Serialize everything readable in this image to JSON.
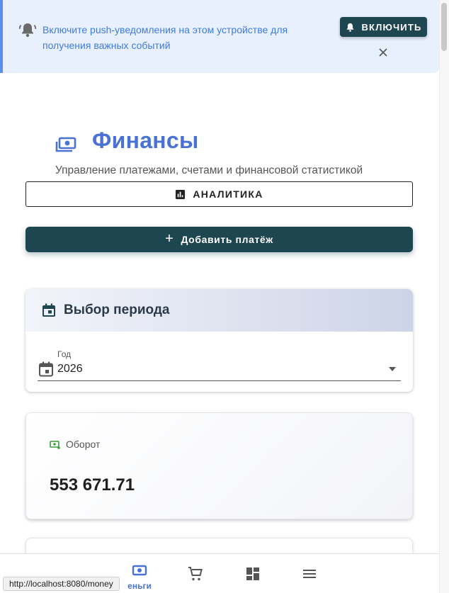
{
  "banner": {
    "text": "Включите push-уведомления на этом устройстве для получения важных событий",
    "enable_label": "ВКЛЮЧИТЬ"
  },
  "header": {
    "title": "Финансы",
    "subtitle": "Управление платежами, счетами и финансовой статистикой"
  },
  "actions": {
    "analytics_label": "АНАЛИТИКА",
    "add_payment_label": "Добавить платёж"
  },
  "period": {
    "title": "Выбор периода",
    "year_label": "Год",
    "year_value": "2026"
  },
  "stats": [
    {
      "label": "Оборот",
      "value": "553 671.71"
    }
  ],
  "bottom_nav": {
    "money_label": "еньги"
  },
  "status_url": "http://localhost:8080/money",
  "colors": {
    "accent": "#4a72d6",
    "primary_dark": "#1d4651",
    "banner_bg": "#e8f0fd",
    "banner_text": "#3f7be0",
    "stat_icon": "#3a9a3a"
  }
}
